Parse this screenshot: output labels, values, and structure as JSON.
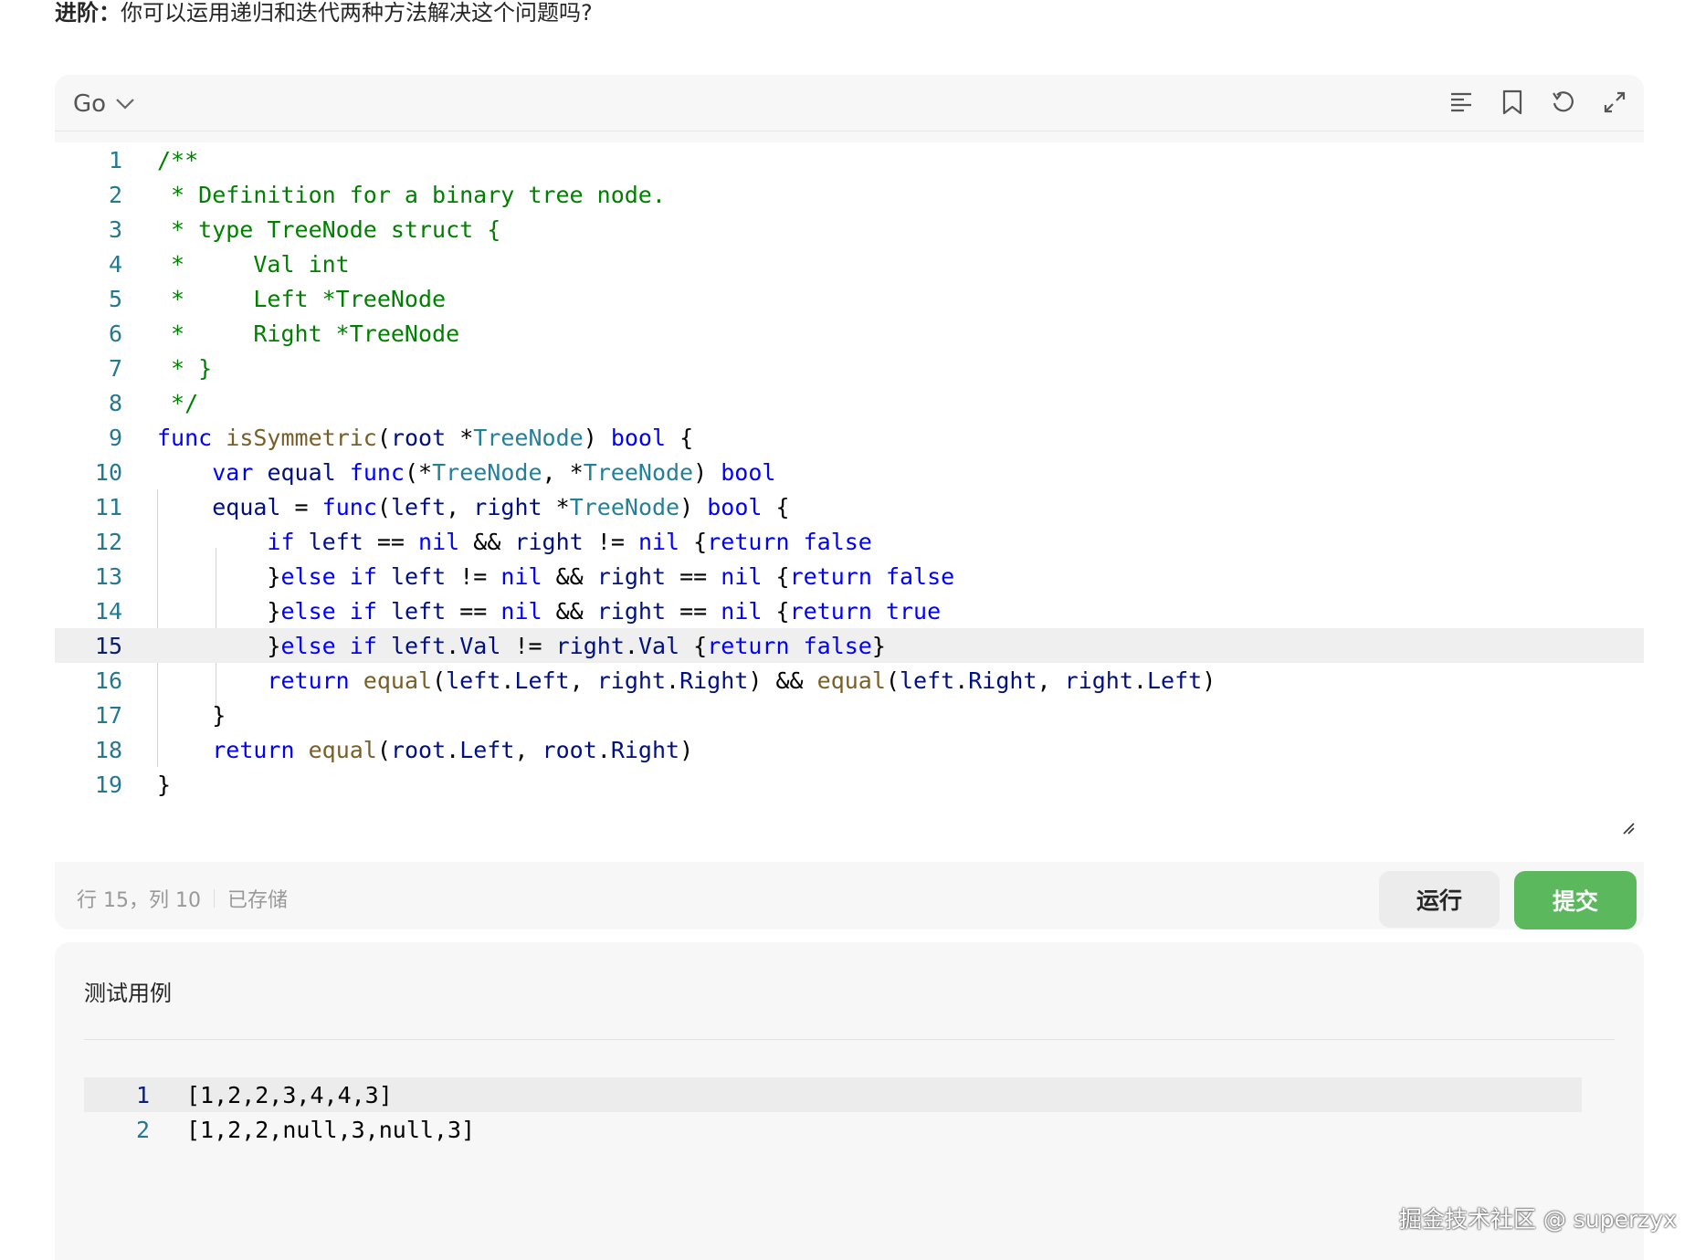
{
  "question": {
    "label": "进阶：",
    "text": "你可以运用递归和迭代两种方法解决这个问题吗?"
  },
  "editor": {
    "language": "Go",
    "toolbar_icons": [
      "format-icon",
      "bookmark-icon",
      "reset-icon",
      "fullscreen-icon"
    ],
    "code_lines": [
      {
        "num": "1",
        "text": "/**"
      },
      {
        "num": "2",
        "text": " * Definition for a binary tree node."
      },
      {
        "num": "3",
        "text": " * type TreeNode struct {"
      },
      {
        "num": "4",
        "text": " *     Val int"
      },
      {
        "num": "5",
        "text": " *     Left *TreeNode"
      },
      {
        "num": "6",
        "text": " *     Right *TreeNode"
      },
      {
        "num": "7",
        "text": " * }"
      },
      {
        "num": "8",
        "text": " */"
      },
      {
        "num": "9",
        "text": "func isSymmetric(root *TreeNode) bool {"
      },
      {
        "num": "10",
        "text": "    var equal func(*TreeNode, *TreeNode) bool"
      },
      {
        "num": "11",
        "text": "    equal = func(left, right *TreeNode) bool {"
      },
      {
        "num": "12",
        "text": "        if left == nil && right != nil {return false"
      },
      {
        "num": "13",
        "text": "        }else if left != nil && right == nil {return false"
      },
      {
        "num": "14",
        "text": "        }else if left == nil && right == nil {return true"
      },
      {
        "num": "15",
        "text": "        }else if left.Val != right.Val {return false}"
      },
      {
        "num": "16",
        "text": "        return equal(left.Left, right.Right) && equal(left.Right, right.Left)"
      },
      {
        "num": "17",
        "text": "    }"
      },
      {
        "num": "18",
        "text": "    return equal(root.Left, root.Right)"
      },
      {
        "num": "19",
        "text": "}"
      }
    ],
    "active_line": 15
  },
  "status": {
    "position": "行 15，列 10",
    "saved": "已存储"
  },
  "buttons": {
    "run": "运行",
    "submit": "提交"
  },
  "testcase": {
    "title": "测试用例",
    "lines": [
      {
        "num": "1",
        "text": "[1,2,2,3,4,4,3]"
      },
      {
        "num": "2",
        "text": "[1,2,2,null,3,null,3]"
      }
    ]
  },
  "watermark": "掘金技术社区 @ superzyx",
  "colors": {
    "submit_green": "#5cb85c",
    "comment_green": "#008000",
    "keyword_blue": "#0000ff",
    "line_number": "#237893"
  }
}
